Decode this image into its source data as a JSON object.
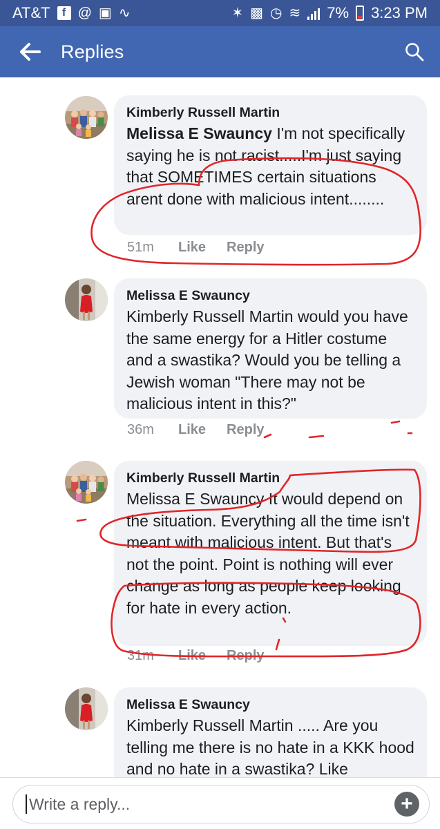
{
  "status_bar": {
    "carrier": "AT&T",
    "battery": "7%",
    "time": "3:23 PM"
  },
  "app_bar": {
    "title": "Replies"
  },
  "comments": [
    {
      "author": "Kimberly Russell Martin",
      "mention": "Melissa E Swauncy",
      "text": " I'm not specifically saying he is not racist.....I'm just saying that SOMETIMES certain situations arent done with malicious intent........",
      "time": "51m",
      "like": "Like",
      "reply": "Reply"
    },
    {
      "author": "Melissa E Swauncy",
      "mention": "",
      "text": "Kimberly Russell Martin would you have the same energy for a Hitler costume and a swastika? Would you be telling a Jewish woman \"There may not be malicious intent in this?\"",
      "time": "36m",
      "like": "Like",
      "reply": "Reply"
    },
    {
      "author": "Kimberly Russell Martin",
      "mention": "",
      "text": "Melissa E Swauncy It would depend on the situation. Everything all the time isn't meant with malicious intent. But that's not the point. Point is nothing will ever change as long as people keep looking for hate in every action.",
      "time": "31m",
      "like": "Like",
      "reply": "Reply"
    },
    {
      "author": "Melissa E Swauncy",
      "mention": "",
      "text": "Kimberly Russell Martin ..... Are you telling me there is no hate in a KKK hood and no hate in a swastika? Like",
      "time": "",
      "like": "",
      "reply": ""
    }
  ],
  "reply_bar": {
    "placeholder": "Write a reply..."
  },
  "colors": {
    "status_bar": "#3a5696",
    "app_bar": "#4267b2",
    "bubble": "#f0f2f5",
    "annotation_ink": "#e0262a"
  }
}
